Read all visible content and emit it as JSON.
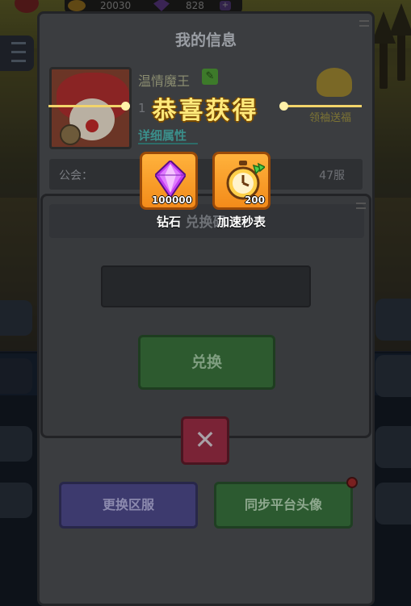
{
  "topbar": {
    "coins": "20030",
    "gems": "828"
  },
  "info_panel": {
    "title": "我的信息",
    "player_name": "温情魔王",
    "level_text": "1",
    "detail_link": "详细属性",
    "gift_label": "领袖送福",
    "guild_label": "公会：",
    "server_text": "47服",
    "change_server_label": "更换区服",
    "sync_avatar_label": "同步平台头像"
  },
  "exchange_dialog": {
    "title": "兑换码",
    "input_value": "",
    "exchange_button_label": "兑换",
    "close_label": "✕"
  },
  "reward_popup": {
    "title": "恭喜获得",
    "items": [
      {
        "name": "钻石",
        "quantity": "100000",
        "icon": "diamond-icon"
      },
      {
        "name": "加速秒表",
        "quantity": "200",
        "icon": "stopwatch-icon"
      }
    ]
  },
  "colors": {
    "reward_gold": "#ffe97a",
    "reward_item_bg": "#f5a028",
    "exchange_green": "#2d5a2f",
    "close_red": "#7a2336",
    "change_server_purple": "#3d3a6e"
  }
}
